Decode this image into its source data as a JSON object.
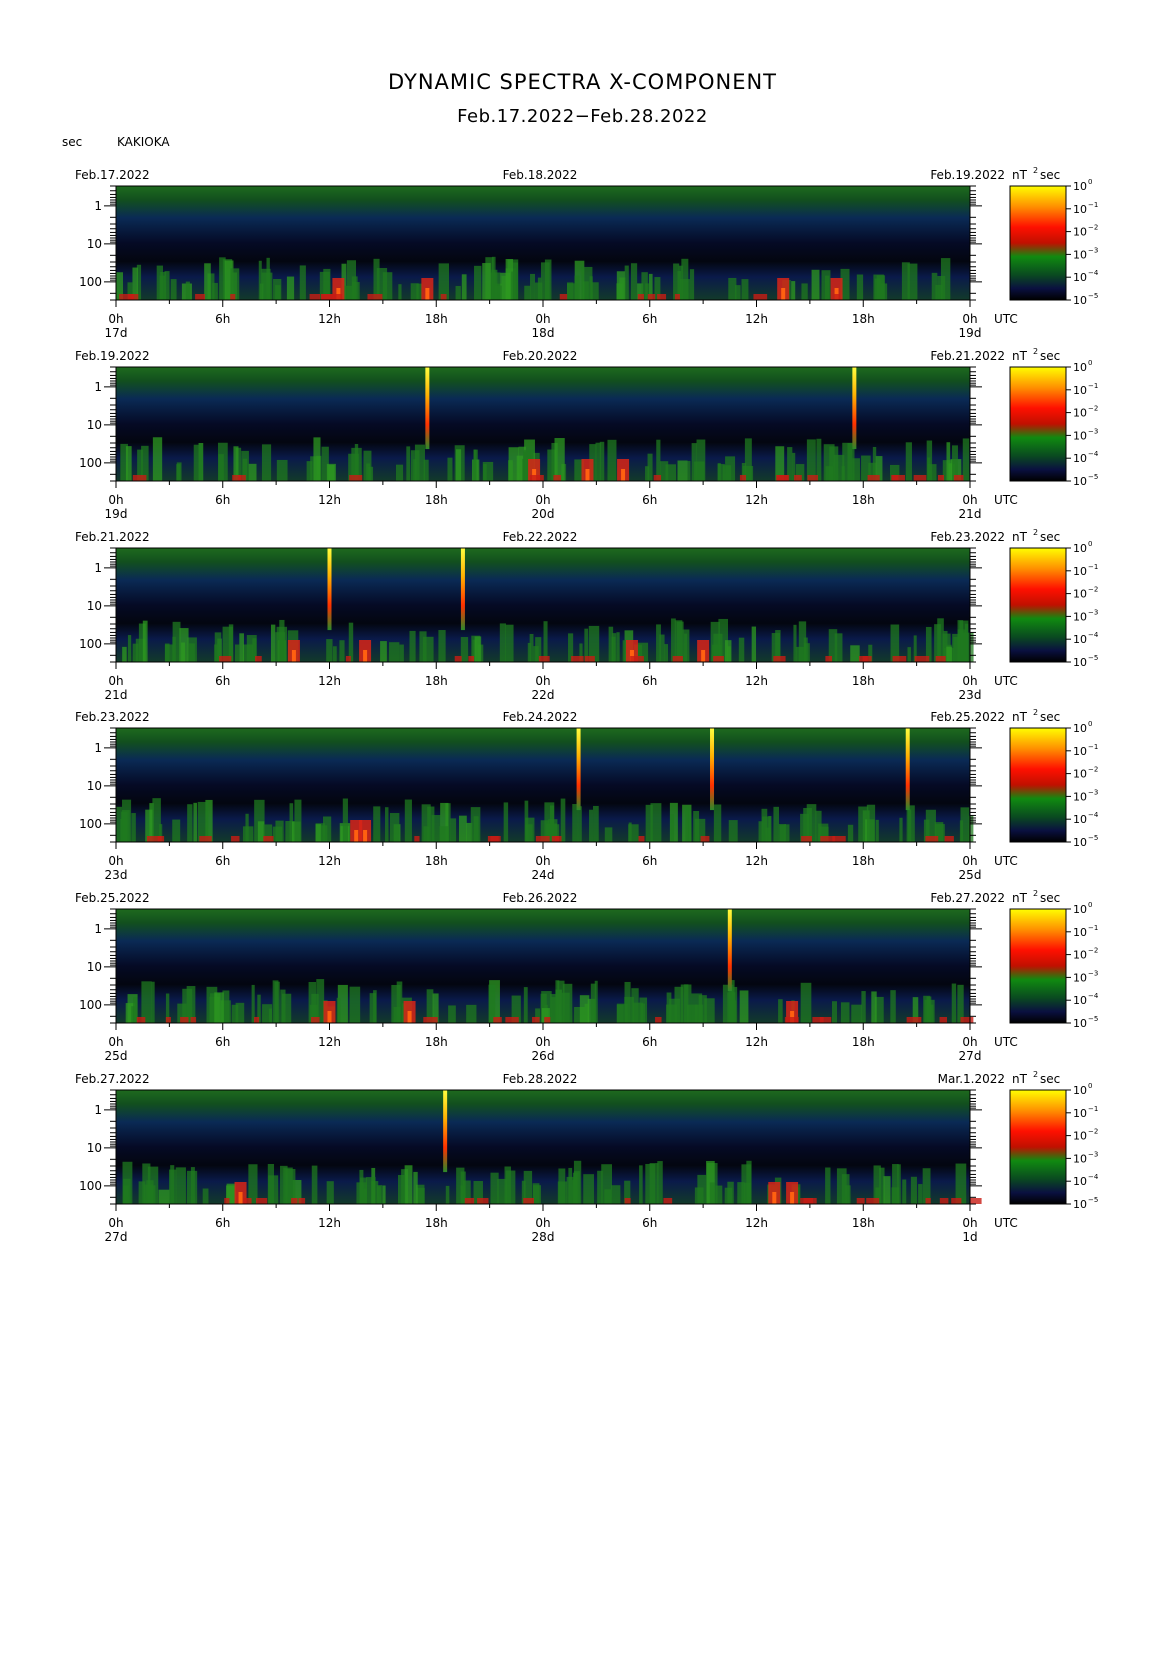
{
  "title": "DYNAMIC SPECTRA X-COMPONENT",
  "subtitle": "Feb.17.2022−Feb.28.2022",
  "period_unit": "sec",
  "station": "KAKIOKA",
  "power_unit": "nT",
  "power_unit_exp": "2",
  "power_unit_sec": "sec",
  "utc_label": "UTC",
  "colors": {
    "background": "#000000",
    "low": "#0a1a5c",
    "mid": "#1f7a1f",
    "high": "#e0201a",
    "peak": "#ffe000"
  },
  "chart_data": {
    "type": "heatmap",
    "x_unit": "hours UTC",
    "y_unit": "sec",
    "y_scale": "log",
    "y_ticks": [
      "1",
      "10",
      "100"
    ],
    "x_ticks": [
      "0h",
      "6h",
      "12h",
      "18h",
      "0h",
      "6h",
      "12h",
      "18h",
      "0h"
    ],
    "color_scale": {
      "scale": "log",
      "base": "10",
      "exponents": [
        "0",
        "−1",
        "−2",
        "−3",
        "−4",
        "−5"
      ],
      "colors": [
        "#ffff00",
        "#ff8000",
        "#ff0000",
        "#008000",
        "#000050",
        "#000000"
      ]
    },
    "panels": [
      {
        "start_date": "Feb.17.2022",
        "mid_date": "Feb.18.2022",
        "end_date": "Feb.19.2022",
        "day_labels": [
          "17d",
          "18d",
          "19d"
        ],
        "spikes_hour": [],
        "red_bursts_hour": [
          17.5,
          12.5,
          37.5,
          40.5
        ]
      },
      {
        "start_date": "Feb.19.2022",
        "mid_date": "Feb.20.2022",
        "end_date": "Feb.21.2022",
        "day_labels": [
          "19d",
          "20d",
          "21d"
        ],
        "spikes_hour": [
          17.5,
          41.5
        ],
        "red_bursts_hour": [
          23.5,
          26.5,
          28.5
        ]
      },
      {
        "start_date": "Feb.21.2022",
        "mid_date": "Feb.22.2022",
        "end_date": "Feb.23.2022",
        "day_labels": [
          "21d",
          "22d",
          "23d"
        ],
        "spikes_hour": [
          12,
          19.5
        ],
        "red_bursts_hour": [
          10,
          14,
          29,
          33
        ]
      },
      {
        "start_date": "Feb.23.2022",
        "mid_date": "Feb.24.2022",
        "end_date": "Feb.25.2022",
        "day_labels": [
          "23d",
          "24d",
          "25d"
        ],
        "spikes_hour": [
          26,
          33.5,
          44.5
        ],
        "red_bursts_hour": [
          13.5,
          14
        ]
      },
      {
        "start_date": "Feb.25.2022",
        "mid_date": "Feb.26.2022",
        "end_date": "Feb.27.2022",
        "day_labels": [
          "25d",
          "26d",
          "27d"
        ],
        "spikes_hour": [
          34.5
        ],
        "red_bursts_hour": [
          12,
          16.5,
          38
        ]
      },
      {
        "start_date": "Feb.27.2022",
        "mid_date": "Feb.28.2022",
        "end_date": "Mar.1.2022",
        "day_labels": [
          "27d",
          "28d",
          "1d"
        ],
        "spikes_hour": [
          18.5
        ],
        "red_bursts_hour": [
          7,
          37,
          38
        ]
      }
    ]
  }
}
